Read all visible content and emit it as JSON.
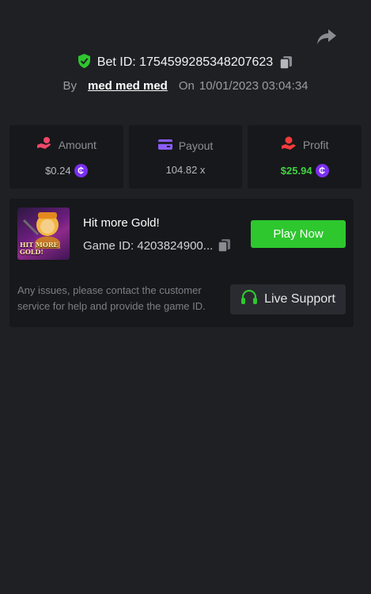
{
  "bet": {
    "id_label": "Bet ID: 1754599285348207623",
    "by_label": "By",
    "user_name": "med med med",
    "on_label": "On",
    "timestamp": "10/01/2023 03:04:34"
  },
  "stats": {
    "amount": {
      "label": "Amount",
      "value": "$0.24"
    },
    "payout": {
      "label": "Payout",
      "value": "104.82 x"
    },
    "profit": {
      "label": "Profit",
      "value": "$25.94"
    }
  },
  "game": {
    "title": "Hit more Gold!",
    "id_text": "Game ID: 4203824900...",
    "thumbnail_text": "HIT MORE GOLD!",
    "play_label": "Play Now",
    "help_text": "Any issues, please contact the customer service for help and provide the game ID.",
    "support_label": "Live Support"
  },
  "icons": {
    "share": "share-icon",
    "verified": "shield-check-icon",
    "copy": "copy-icon",
    "amount": "hand-coins-icon",
    "payout": "wallet-icon",
    "profit": "hand-money-icon",
    "coin": "coin-icon",
    "support": "headset-icon"
  },
  "colors": {
    "background": "#1f2024",
    "panel": "#17181b",
    "accent_green": "#2ec72e",
    "profit_green": "#3fd33f",
    "coin_purple": "#7b2ff0",
    "amount_icon": "#f0486a",
    "payout_icon": "#8a5cf6",
    "profit_icon": "#f03c3c"
  }
}
